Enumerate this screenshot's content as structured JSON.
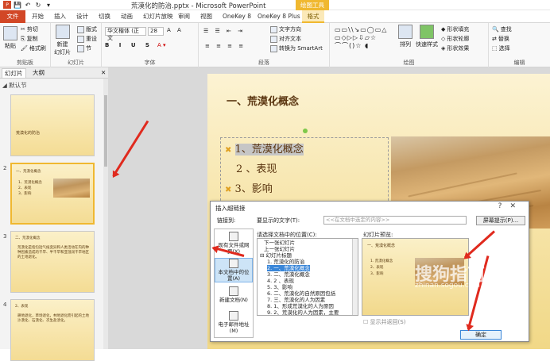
{
  "window": {
    "title": "荒漠化的防治.pptx - Microsoft PowerPoint",
    "context_header": "绘图工具"
  },
  "ribbon_tabs": [
    "文件",
    "开始",
    "插入",
    "设计",
    "切换",
    "动画",
    "幻灯片放映",
    "审阅",
    "视图",
    "OneKey 8",
    "OneKey 8 Plus",
    "格式"
  ],
  "ribbon": {
    "clipboard": {
      "label": "剪贴板",
      "paste": "粘贴",
      "cut": "剪切",
      "copy": "复制",
      "format_painter": "格式刷"
    },
    "slides": {
      "label": "幻灯片",
      "new_slide": "新建\n幻灯片",
      "layout": "版式",
      "reset": "重设",
      "section": "节"
    },
    "font": {
      "label": "字体",
      "font_name": "华文楷体 (正文",
      "font_size": "28"
    },
    "paragraph": {
      "label": "段落",
      "text_direction": "文字方向",
      "align_text": "对齐文本",
      "smartart": "转换为 SmartArt"
    },
    "drawing": {
      "label": "绘图",
      "arrange": "排列",
      "quick_styles": "快速样式",
      "shape_fill": "形状填充",
      "shape_outline": "形状轮廓",
      "shape_effects": "形状效果"
    },
    "editing": {
      "label": "编辑",
      "find": "查找",
      "replace": "替换",
      "select": "选择"
    }
  },
  "pane": {
    "tabs": [
      "幻灯片",
      "大纲"
    ],
    "section": "默认节",
    "thumbnails": [
      {
        "num": "1",
        "lines": [
          "荒漠化的防治"
        ]
      },
      {
        "num": "2",
        "lines": [
          "一、荒漠化概念",
          "1、荒漠化概念",
          "2、表现",
          "3、影响"
        ]
      },
      {
        "num": "3",
        "lines": [
          "二、荒漠化概念",
          "荒漠化是指包括气候变异和人类活动在内的种种因素造成的干旱、半干旱和亚湿润干旱地区的土地退化。"
        ]
      },
      {
        "num": "4",
        "lines": [
          "2、表现",
          "耕地退化，草场退化，林地退化而引起的土地沙漠化、石漠化、次生盐渍化。"
        ]
      }
    ]
  },
  "slide": {
    "title": "一、荒漠化概念",
    "bullets": [
      {
        "mark": "✖",
        "text": "1、荒漠化概念"
      },
      {
        "mark": "",
        "text": "2 、表现"
      },
      {
        "mark": "✖",
        "text": "3、影响"
      }
    ]
  },
  "dialog": {
    "title": "插入超链接",
    "link_to_label": "链接到:",
    "display_text_label": "要显示的文字(T):",
    "display_text_value": "<<在文档中选定的内容>>",
    "screentip_button": "屏幕提示(P)...",
    "place_label": "请选择文档中的位置(C):",
    "preview_label": "幻灯片预览:",
    "link_options": [
      {
        "label": "现有文件或网\n页(X)"
      },
      {
        "label": "本文档中的位\n置(A)"
      },
      {
        "label": "新建文档(N)"
      },
      {
        "label": "电子邮件地址\n(M)"
      }
    ],
    "tree": [
      "下一张幻灯片",
      "上一张幻灯片",
      "幻灯片标题",
      "1. 荒漠化的防治",
      "2. 一、荒漠化概念",
      "3. 二、荒漠化概念",
      "4. 2 、表现",
      "5. 3、影响",
      "6. 二、荒漠化的自然原因包括",
      "7. 三、荒漠化的人为因素",
      "8. 1、形成荒漠化的人为原因",
      "9. 2、荒漠化的人为因素，主要"
    ],
    "preview_lines": [
      "一、荒漠化概念",
      "1. 荒漠化概念",
      "2、表现",
      "3、影响"
    ],
    "show_return": "显示并返回(S)",
    "ok": "确定",
    "help": "?"
  },
  "watermark": {
    "text": "搜狗指南",
    "url": "zhinan.sogou.com"
  }
}
